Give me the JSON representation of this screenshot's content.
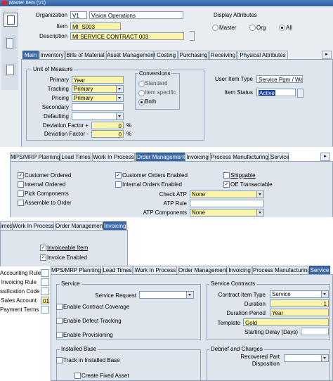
{
  "window": {
    "title": "Master Item (V1)"
  },
  "header": {
    "organization_label": "Organization",
    "organization_code": "V1",
    "organization_name": "Vision Operations",
    "item_label": "Item",
    "item_value": "MI_S003",
    "description_label": "Description",
    "description_value": "MI SERVICE CONTRACT 003",
    "display_attributes": {
      "title": "Display Attributes",
      "options": [
        "Master",
        "Org",
        "All"
      ],
      "selected": "All"
    }
  },
  "main_tabs": [
    "Main",
    "Inventory",
    "Bills of Material",
    "Asset Management",
    "Costing",
    "Purchasing",
    "Receiving",
    "Physical Attributes"
  ],
  "main": {
    "uom_title": "Unit of Measure",
    "primary_label": "Primary",
    "primary_value": "Year",
    "tracking_label": "Tracking",
    "tracking_value": "Primary",
    "pricing_label": "Pricing",
    "pricing_value": "Primary",
    "secondary_label": "Secondary",
    "secondary_value": "",
    "defaulting_label": "Defaulting",
    "defaulting_value": "",
    "dev_plus_label": "Deviation Factor +",
    "dev_plus_value": "0",
    "dev_minus_label": "Deviation Factor -",
    "dev_minus_value": "0",
    "percent": "%",
    "conversions_title": "Conversions",
    "conversions_options": [
      "Standard",
      "Item specific",
      "Both"
    ],
    "conversions_selected": "Both",
    "user_item_type_label": "User Item Type",
    "user_item_type_value": "Service Pgm / Warr",
    "item_status_label": "Item Status",
    "item_status_value": "Active"
  },
  "om_tabs": [
    "MPS/MRP Planning",
    "Lead Times",
    "Work In Process",
    "Order Management",
    "Invoicing",
    "Process Manufacturing",
    "Service"
  ],
  "om": {
    "customer_ordered": "Customer Ordered",
    "customer_orders_enabled": "Customer Orders Enabled",
    "shippable": "Shippable",
    "internal_ordered": "Internal Ordered",
    "internal_orders_enabled": "Internal Orders Enabled",
    "oe_transactable": "OE Transactable",
    "pick_components": "Pick Components",
    "assemble_to_order": "Assemble to Order",
    "check_atp_label": "Check ATP",
    "check_atp_value": "None",
    "atp_rule_label": "ATP Rule",
    "atp_rule_value": "",
    "atp_components_label": "ATP Components",
    "atp_components_value": "None"
  },
  "inv_tabs": [
    "imes",
    "Work In Process",
    "Order Management",
    "Invoicing"
  ],
  "inv": {
    "invoiceable_item": "Invoiceable Item",
    "invoice_enabled": "Invoice Enabled",
    "accounting_rule": "Accounting Rule",
    "invoicing_rule": "Invoicing Rule",
    "tax_code": "ssification Code",
    "sales_account_label": "Sales Account",
    "sales_account_value": "01-",
    "payment_terms": "Payment Terms"
  },
  "svc_tabs": [
    "MPS/MRP Planning",
    "Lead Times",
    "Work In Process",
    "Order Management",
    "Invoicing",
    "Process Manufacturing",
    "Service"
  ],
  "svc": {
    "service_title": "Service",
    "service_request_label": "Service Request",
    "enable_contract_coverage": "Enable Contract Coverage",
    "enable_defect_tracking": "Enable Defect Tracking",
    "enable_provisioning": "Enable Provisioning",
    "contracts_title": "Service Contracts",
    "contract_item_type_label": "Contract Item Type",
    "contract_item_type_value": "Service",
    "duration_label": "Duration",
    "duration_value": "1",
    "duration_period_label": "Duration Period",
    "duration_period_value": "Year",
    "template_label": "Template",
    "template_value": "Gold",
    "starting_delay_label": "Starting Delay (Days)",
    "installed_base_title": "Installed Base",
    "track_installed_base": "Track in Installed Base",
    "create_fixed_asset": "Create Fixed Asset",
    "debrief_title": "Debrief and Charges",
    "recovered_part_label": "Recovered Part",
    "recovered_part_label2": "Disposition"
  },
  "colors": {
    "accent": "#3b68a6",
    "required": "#fcf4a8",
    "panel": "#dfe5ec",
    "titlebar": "#3a6ea5"
  }
}
